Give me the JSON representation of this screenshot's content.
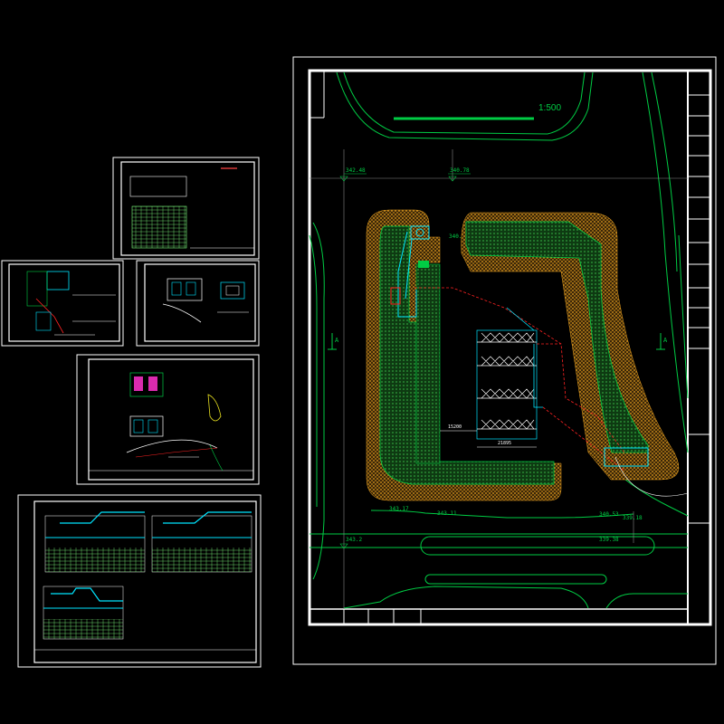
{
  "site_plan": {
    "scale": "1:500",
    "elev_top_left": "342.48",
    "elev_top_mid": "340.78",
    "elev_entrance": "340.18",
    "elev_bottom_left": "343.2",
    "elev_bottom_right": "339.38",
    "elev_road_1": "343.17",
    "elev_road_2": "343.11",
    "elev_road_3": "340.53",
    "elev_road_4": "339.18",
    "dim_1": "15200",
    "dim_2": "21895",
    "section_mark_left": "A",
    "section_mark_right": "A"
  },
  "colors": {
    "frame": "#ffffff",
    "line": "#00cc44",
    "cyan": "#00e5ff",
    "red": "#ff2222",
    "orange": "#e8a020",
    "hatch": "#1f7a2a",
    "magenta": "#ff33cc"
  }
}
